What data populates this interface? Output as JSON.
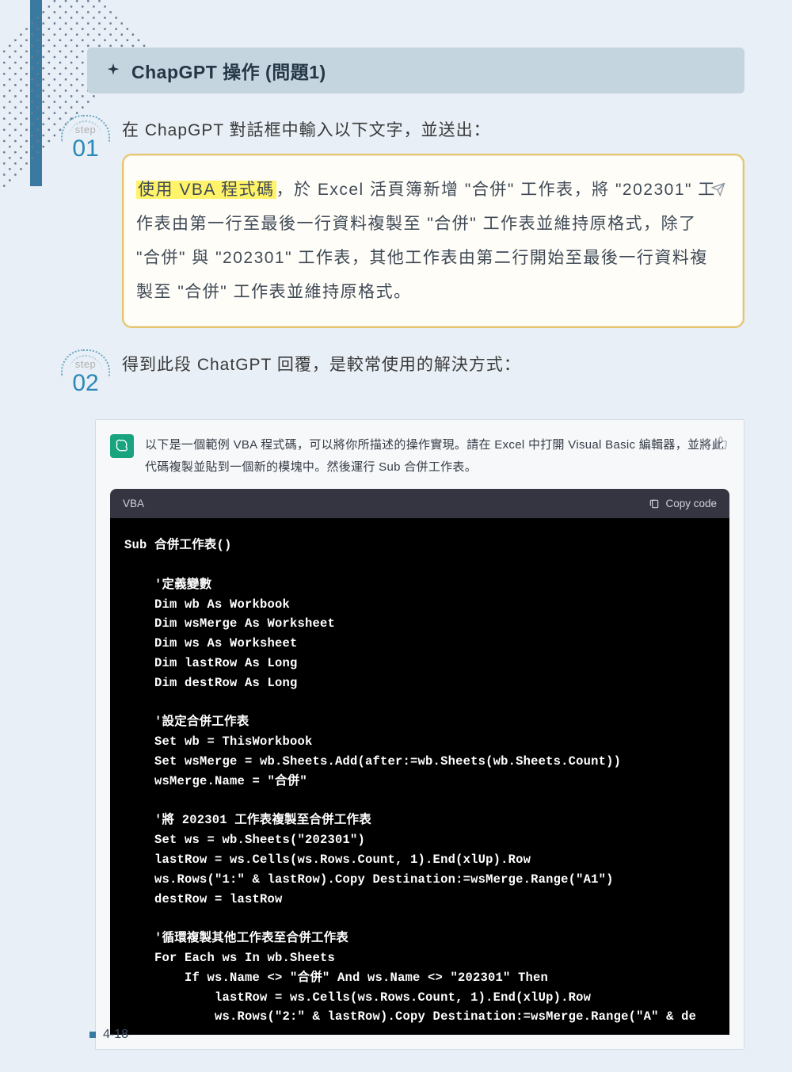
{
  "header": {
    "title": "ChapGPT 操作 (問題1)"
  },
  "step1": {
    "label": "step",
    "number": "01",
    "heading": "在 ChapGPT 對話框中輸入以下文字，並送出：",
    "prompt_highlight": "使用 VBA 程式碼",
    "prompt_rest": "，於 Excel 活頁簿新增 \"合併\" 工作表，將 \"202301\" 工作表由第一行至最後一行資料複製至 \"合併\" 工作表並維持原格式，除了 \"合併\" 與 \"202301\" 工作表，其他工作表由第二行開始至最後一行資料複製至 \"合併\" 工作表並維持原格式。"
  },
  "step2": {
    "label": "step",
    "number": "02",
    "heading": "得到此段 ChatGPT 回覆，是較常使用的解決方式："
  },
  "chat": {
    "intro": "以下是一個範例 VBA 程式碼，可以將你所描述的操作實現。請在 Excel 中打開 Visual Basic 編輯器，並將此代碼複製並貼到一個新的模塊中。然後運行 Sub 合併工作表。",
    "code_lang": "VBA",
    "copy_label": "Copy code",
    "code": "Sub 合併工作表()\n\n    '定義變數\n    Dim wb As Workbook\n    Dim wsMerge As Worksheet\n    Dim ws As Worksheet\n    Dim lastRow As Long\n    Dim destRow As Long\n\n    '設定合併工作表\n    Set wb = ThisWorkbook\n    Set wsMerge = wb.Sheets.Add(after:=wb.Sheets(wb.Sheets.Count))\n    wsMerge.Name = \"合併\"\n\n    '將 202301 工作表複製至合併工作表\n    Set ws = wb.Sheets(\"202301\")\n    lastRow = ws.Cells(ws.Rows.Count, 1).End(xlUp).Row\n    ws.Rows(\"1:\" & lastRow).Copy Destination:=wsMerge.Range(\"A1\")\n    destRow = lastRow\n\n    '循環複製其他工作表至合併工作表\n    For Each ws In wb.Sheets\n        If ws.Name <> \"合併\" And ws.Name <> \"202301\" Then\n            lastRow = ws.Cells(ws.Rows.Count, 1).End(xlUp).Row\n            ws.Rows(\"2:\" & lastRow).Copy Destination:=wsMerge.Range(\"A\" & de"
  },
  "footer": {
    "page": "4-18"
  }
}
